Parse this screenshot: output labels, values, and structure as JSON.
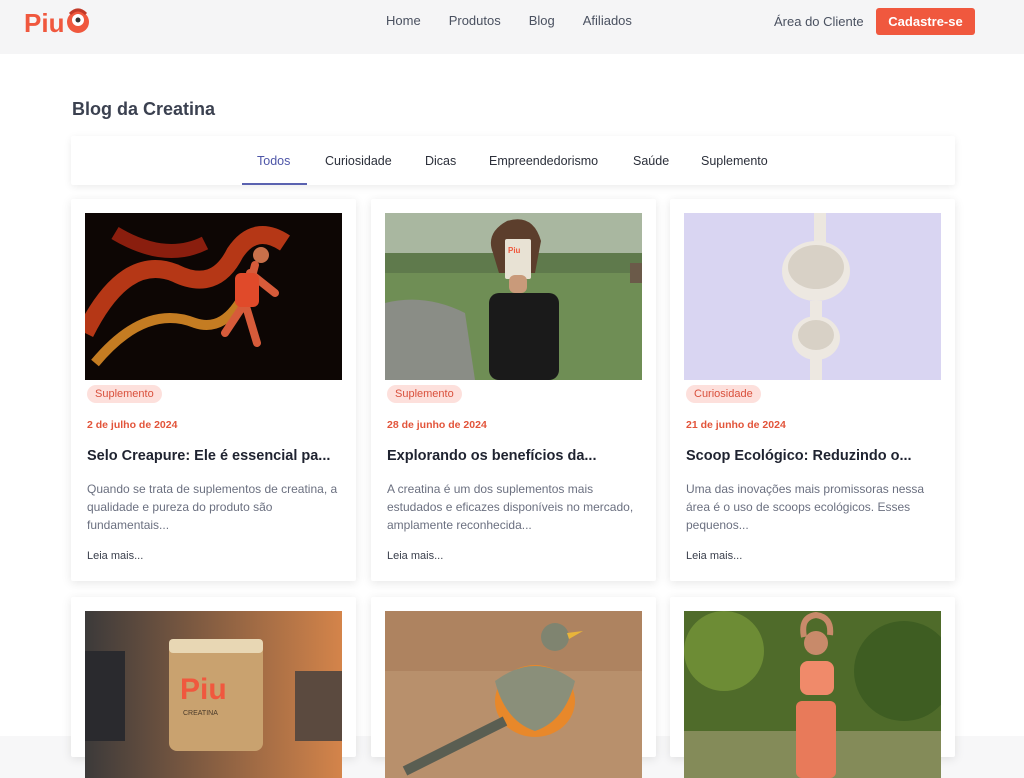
{
  "brand": {
    "name": "Piu"
  },
  "nav": {
    "items": [
      "Home",
      "Produtos",
      "Blog",
      "Afiliados"
    ],
    "client_area": "Área do Cliente",
    "signup": "Cadastre-se"
  },
  "page": {
    "title": "Blog da Creatina"
  },
  "tabs": [
    "Todos",
    "Curiosidade",
    "Dicas",
    "Empreendedorismo",
    "Saúde",
    "Suplemento"
  ],
  "active_tab": "Todos",
  "posts": [
    {
      "category": "Suplemento",
      "date": "2 de julho de 2024",
      "title": "Selo Creapure: Ele é essencial pa...",
      "excerpt": "Quando se trata de suplementos de creatina, a qualidade e pureza do produto são fundamentais...",
      "read_more": "Leia mais..."
    },
    {
      "category": "Suplemento",
      "date": "28 de junho de 2024",
      "title": "Explorando os benefícios da...",
      "excerpt": "A creatina é um dos suplementos mais estudados e eficazes disponíveis no mercado, amplamente reconhecida...",
      "read_more": "Leia mais..."
    },
    {
      "category": "Curiosidade",
      "date": "21 de junho de 2024",
      "title": "Scoop Ecológico: Reduzindo o...",
      "excerpt": "Uma das inovações mais promissoras nessa área é o uso de scoops ecológicos. Esses pequenos...",
      "read_more": "Leia mais..."
    }
  ],
  "jar_label": "Piu",
  "jar_sub": "CREATINA",
  "colors": {
    "accent": "#f0583e",
    "tab_active": "#4e56a8",
    "badge_bg": "#fde0dc"
  }
}
